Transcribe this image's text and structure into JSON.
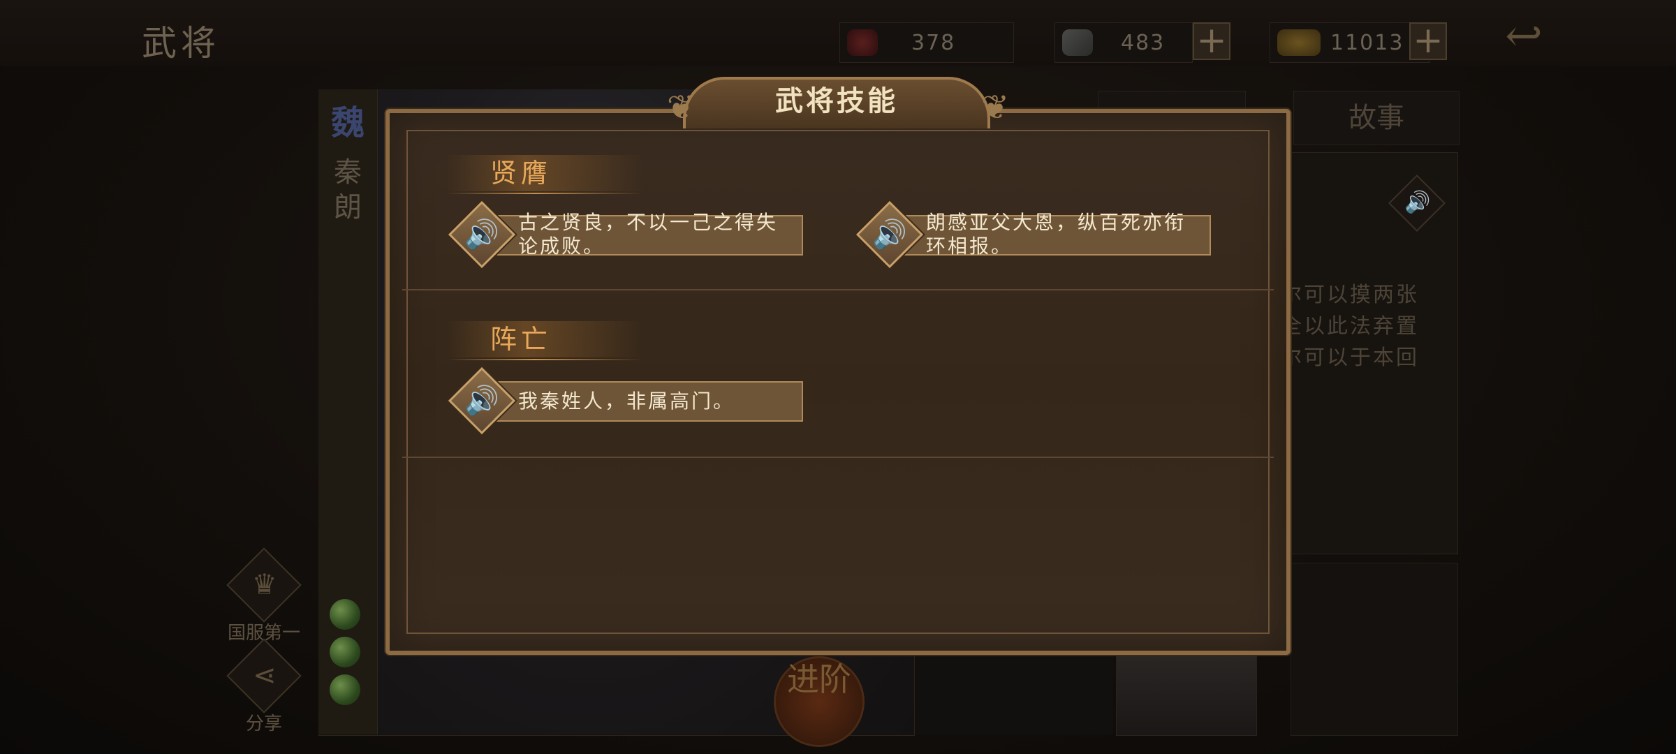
{
  "header": {
    "title": "武将",
    "resources": [
      {
        "icon": "gem-icon",
        "value": "378"
      },
      {
        "icon": "scroll-icon",
        "value": "483"
      },
      {
        "icon": "gold-ingot-icon",
        "value": "11013"
      }
    ]
  },
  "hero": {
    "faction": "魏",
    "name": "秦朗",
    "side_buttons": [
      "国服第一",
      "分享"
    ],
    "advance_label": "进阶"
  },
  "tabs": [
    "故事"
  ],
  "info": {
    "lines": [
      "尔可以摸两张",
      "全以此法弃置",
      "尔可以于本回"
    ]
  },
  "dialog": {
    "title": "武将技能",
    "skills": [
      {
        "name": "贤膺",
        "lines": [
          "古之贤良，不以一己之得失论成败。",
          "朗感亚父大恩，纵百死亦衔环相报。"
        ]
      },
      {
        "name": "阵亡",
        "lines": [
          "我秦姓人，非属高门。"
        ]
      }
    ]
  },
  "colors": {
    "accent": "#e8a85a",
    "dialog_border": "#8b6a44",
    "voice_box": "#6e5538"
  }
}
